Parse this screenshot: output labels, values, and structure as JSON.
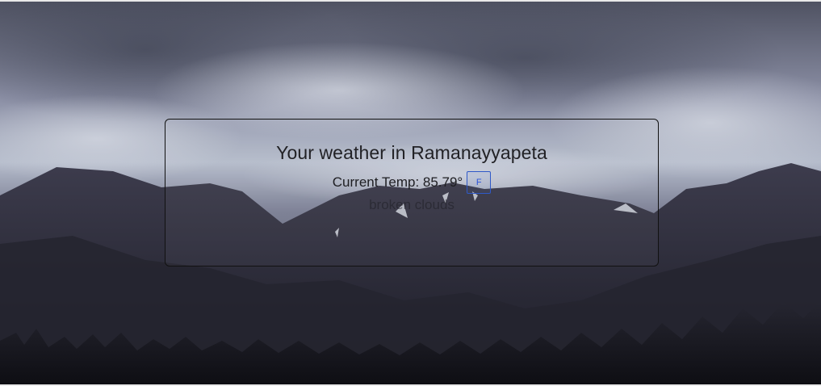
{
  "weather": {
    "title": "Your weather in Ramanayyapeta",
    "temp_label": "Current Temp: 85.79°",
    "unit_button_label": "F",
    "condition": "broken clouds"
  },
  "colors": {
    "card_border": "#111111",
    "unit_button_border": "#2f59c8",
    "unit_button_text": "#2b53d9"
  }
}
